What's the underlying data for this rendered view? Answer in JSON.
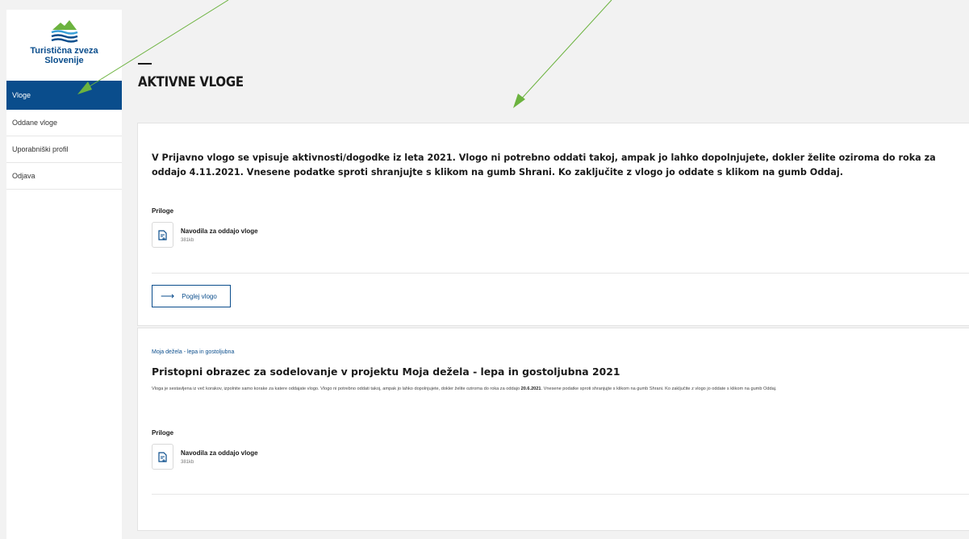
{
  "brand": {
    "name": "Turistična zveza Slovenije",
    "line1": "Turistična zveza",
    "line2": "Slovenije",
    "colors": {
      "primary": "#0a4d8c",
      "green": "#6cb33f",
      "wave": "#3aa0d8"
    }
  },
  "sidebar": {
    "items": [
      {
        "label": "Vloge",
        "active": true
      },
      {
        "label": "Oddane vloge",
        "active": false
      },
      {
        "label": "Uporabniški profil",
        "active": false
      },
      {
        "label": "Odjava",
        "active": false
      }
    ]
  },
  "page": {
    "title": "AKTIVNE VLOGE"
  },
  "card1": {
    "intro": "V Prijavno vlogo se vpisuje aktivnosti/dogodke iz leta 2021. Vlogo ni potrebno oddati takoj, ampak jo lahko dopolnjujete, dokler želite oziroma do roka za oddajo 4.11.2021. Vnesene podatke sproti shranjujte s klikom na gumb Shrani. Ko zaključite z vlogo jo oddate s klikom na gumb Oddaj.",
    "attachments_label": "Priloge",
    "attachment": {
      "name": "Navodila za oddajo vloge",
      "size": "381kb",
      "icon": "document-icon"
    },
    "view_button": "Poglej vlogo"
  },
  "card2": {
    "category": "Moja dežela - lepa in gostoljubna",
    "title": "Pristopni obrazec za sodelovanje v projektu Moja dežela - lepa in gostoljubna 2021",
    "desc_before": "Vloga je sestavljena iz več korakov, izpolnite samo korake za katere oddajate vlogo. Vlogo ni potrebno oddati takoj, ampak jo lahko dopolnjujete, dokler želite oziroma do roka za oddajo ",
    "desc_date": "20.6.2021",
    "desc_after": ". Vnesene podatke sproti shranjujte s klikom na gumb Shrani. Ko zaključite z vlogo jo oddate s klikom na gumb Oddaj.",
    "attachments_label": "Priloge",
    "attachment": {
      "name": "Navodila za oddajo vloge",
      "size": "381kb",
      "icon": "document-icon"
    }
  },
  "annotations": {
    "arrow_color": "#6cb33f"
  }
}
